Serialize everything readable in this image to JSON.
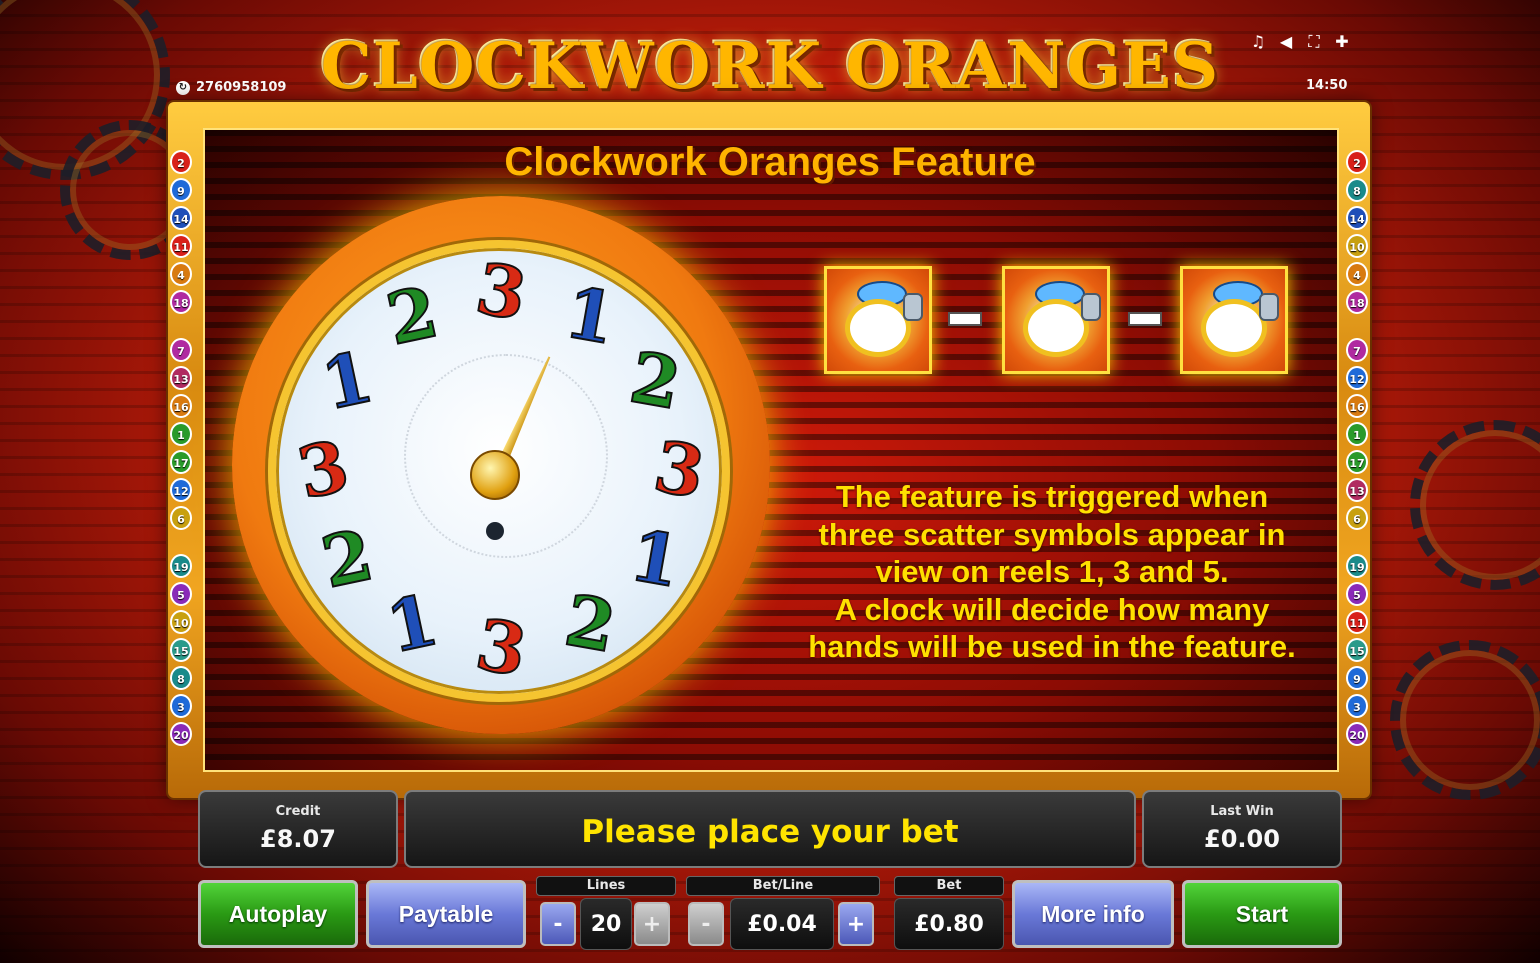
{
  "game": {
    "title": "CLOCKWORK ORANGES",
    "session_id": "2760958109",
    "time": "14:50"
  },
  "top_icons": [
    "music-note-icon",
    "speaker-icon",
    "fullscreen-icon",
    "settings-icon"
  ],
  "paylines": {
    "left": [
      "2",
      "9",
      "14",
      "11",
      "4",
      "18",
      "7",
      "13",
      "16",
      "1",
      "17",
      "12",
      "6",
      "19",
      "5",
      "10",
      "15",
      "8",
      "3",
      "20"
    ],
    "right": [
      "2",
      "8",
      "14",
      "10",
      "4",
      "18",
      "7",
      "12",
      "16",
      "1",
      "17",
      "13",
      "6",
      "19",
      "5",
      "11",
      "15",
      "9",
      "3",
      "20"
    ]
  },
  "feature": {
    "title": "Clockwork Oranges Feature",
    "clock_numbers": [
      {
        "n": "3",
        "color": "red"
      },
      {
        "n": "1",
        "color": "blue"
      },
      {
        "n": "2",
        "color": "green"
      },
      {
        "n": "3",
        "color": "red"
      },
      {
        "n": "1",
        "color": "blue"
      },
      {
        "n": "2",
        "color": "green"
      },
      {
        "n": "3",
        "color": "red"
      },
      {
        "n": "1",
        "color": "blue"
      },
      {
        "n": "2",
        "color": "green"
      },
      {
        "n": "3",
        "color": "red"
      },
      {
        "n": "1",
        "color": "blue"
      },
      {
        "n": "2",
        "color": "green"
      }
    ],
    "description": [
      "The feature is triggered when",
      "three scatter symbols appear in",
      "view on reels 1, 3 and 5.",
      "A clock will decide how many",
      "hands will be used in the feature."
    ]
  },
  "status": {
    "credit_label": "Credit",
    "credit_value": "£8.07",
    "message": "Please place your bet",
    "last_win_label": "Last Win",
    "last_win_value": "£0.00"
  },
  "controls": {
    "autoplay": "Autoplay",
    "paytable": "Paytable",
    "lines_label": "Lines",
    "lines_value": "20",
    "betline_label": "Bet/Line",
    "betline_value": "£0.04",
    "bet_label": "Bet",
    "bet_value": "£0.80",
    "more_info": "More info",
    "start": "Start",
    "minus": "-",
    "plus": "+"
  },
  "colors": {
    "accent_yellow": "#ffe000",
    "title_orange": "#ffb400",
    "green_button": "#2a9a14",
    "blue_button": "#6a79d8"
  }
}
